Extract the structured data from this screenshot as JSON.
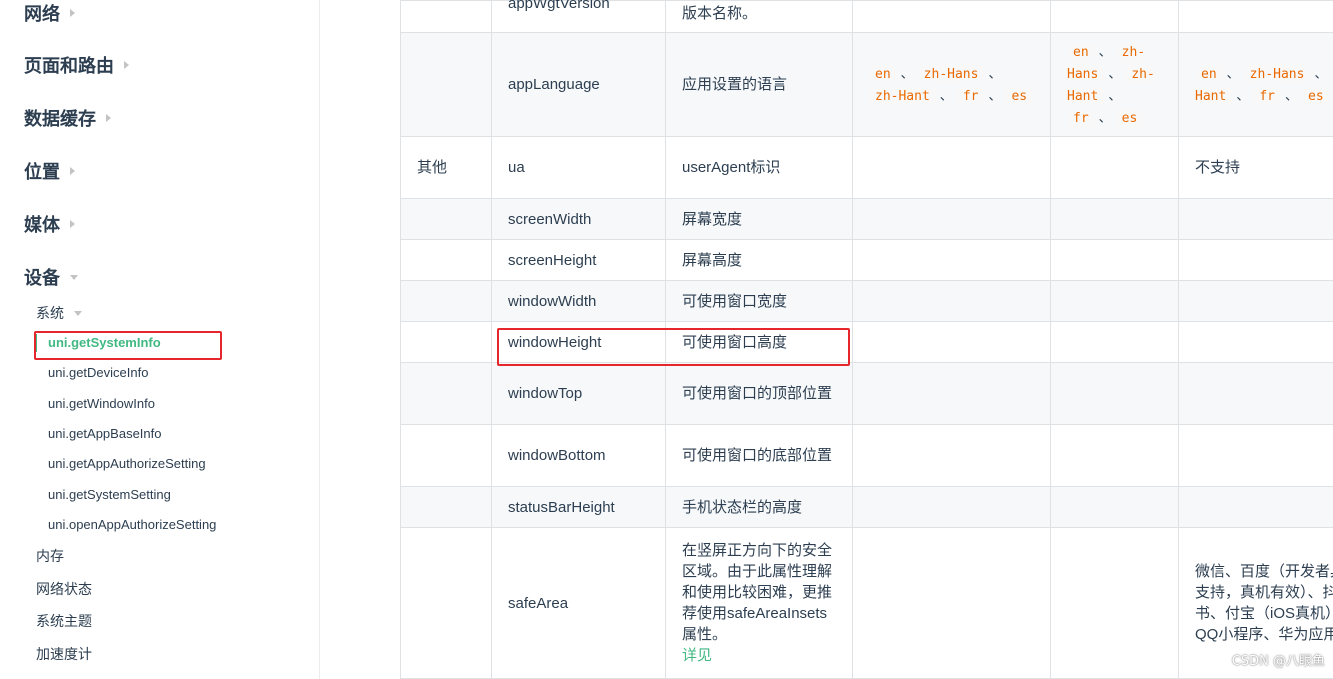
{
  "sidebar": {
    "sections": [
      {
        "label": "网络",
        "expanded": false
      },
      {
        "label": "页面和路由",
        "expanded": false
      },
      {
        "label": "数据缓存",
        "expanded": false
      },
      {
        "label": "位置",
        "expanded": false
      },
      {
        "label": "媒体",
        "expanded": false
      },
      {
        "label": "设备",
        "expanded": true
      }
    ],
    "device_sub": {
      "system": "系统",
      "system_items": [
        "uni.getSystemInfo",
        "uni.getDeviceInfo",
        "uni.getWindowInfo",
        "uni.getAppBaseInfo",
        "uni.getAppAuthorizeSetting",
        "uni.getSystemSetting",
        "uni.openAppAuthorizeSetting"
      ],
      "others": [
        "内存",
        "网络状态",
        "系统主题",
        "加速度计"
      ]
    },
    "active_item": "uni.getSystemInfo",
    "accent_color": "#42b983",
    "highlight_color": "#e5262c"
  },
  "table": {
    "rows": [
      {
        "cat": "",
        "name": "appWgtVersion",
        "desc": "版本名称。",
        "c1": "",
        "c2": "",
        "c3": ""
      },
      {
        "cat": "",
        "name": "appLanguage",
        "desc": "应用设置的语言",
        "c1": "",
        "c2": "",
        "c3": ""
      },
      {
        "cat": "其他",
        "name": "ua",
        "desc": "userAgent标识",
        "c1": "",
        "c2": "",
        "c3": "不支持"
      },
      {
        "cat": "",
        "name": "screenWidth",
        "desc": "屏幕宽度",
        "c1": "",
        "c2": "",
        "c3": ""
      },
      {
        "cat": "",
        "name": "screenHeight",
        "desc": "屏幕高度",
        "c1": "",
        "c2": "",
        "c3": ""
      },
      {
        "cat": "",
        "name": "windowWidth",
        "desc": "可使用窗口宽度",
        "c1": "",
        "c2": "",
        "c3": ""
      },
      {
        "cat": "",
        "name": "windowHeight",
        "desc": "可使用窗口高度",
        "c1": "",
        "c2": "",
        "c3": ""
      },
      {
        "cat": "",
        "name": "windowTop",
        "desc": "可使用窗口的顶部位置",
        "c1": "",
        "c2": "",
        "c3": ""
      },
      {
        "cat": "",
        "name": "windowBottom",
        "desc": "可使用窗口的底部位置",
        "c1": "",
        "c2": "",
        "c3": ""
      },
      {
        "cat": "",
        "name": "statusBarHeight",
        "desc": "手机状态栏的高度",
        "c1": "",
        "c2": "",
        "c3": ""
      },
      {
        "cat": "",
        "name": "safeArea",
        "desc": "在竖屏正方向下的安全区域。由于此属性理解和使用比较困难，更推荐使用safeAreaInsets 属性。",
        "desc_link": "详见",
        "c1": "",
        "c2": "",
        "c3": "微信、百度（开发者具暂不支持，真机有效）、抖音、飞书、付宝（iOS真机）、手、QQ小程序、华为应用"
      }
    ],
    "lang_chips": {
      "col1": [
        "en",
        "zh-Hans",
        "zh-Hant",
        "fr",
        "es"
      ],
      "col2": [
        "en",
        "zh-Hans",
        "zh-Hant",
        "fr",
        "es"
      ],
      "col3": [
        "en",
        "zh-Hans",
        "zh-Hant",
        "fr",
        "es"
      ],
      "separator": "、"
    }
  },
  "watermark": "CSDN @八眼鱼"
}
